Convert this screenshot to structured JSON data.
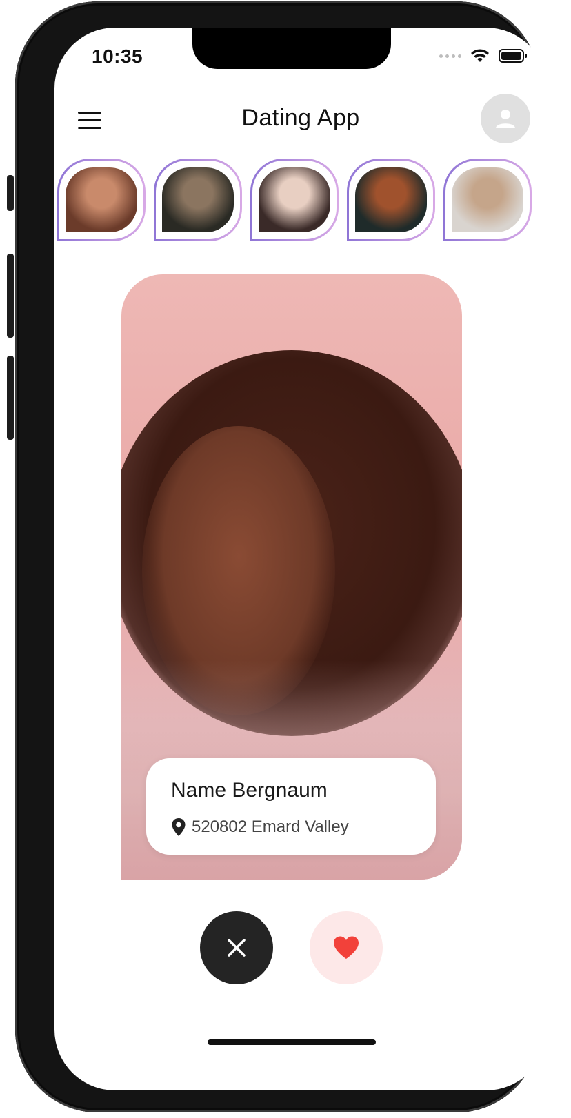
{
  "status_bar": {
    "time": "10:35"
  },
  "app_bar": {
    "title": "Dating App"
  },
  "stories": [
    {
      "name": "story-1",
      "colors": [
        "#6b3b2a",
        "#c98a6b"
      ]
    },
    {
      "name": "story-2",
      "colors": [
        "#2a2a24",
        "#8b7560"
      ]
    },
    {
      "name": "story-3",
      "colors": [
        "#3a2a28",
        "#e8cfc2"
      ]
    },
    {
      "name": "story-4",
      "colors": [
        "#1f2b2a",
        "#a0522d"
      ]
    },
    {
      "name": "story-5",
      "colors": [
        "#d9d4cf",
        "#c5a58a"
      ]
    }
  ],
  "profile_card": {
    "name": "Name Bergnaum",
    "location": "520802 Emard Valley"
  },
  "actions": {
    "dislike_icon": "close-icon",
    "like_icon": "heart-icon",
    "like_color": "#f2413a"
  }
}
